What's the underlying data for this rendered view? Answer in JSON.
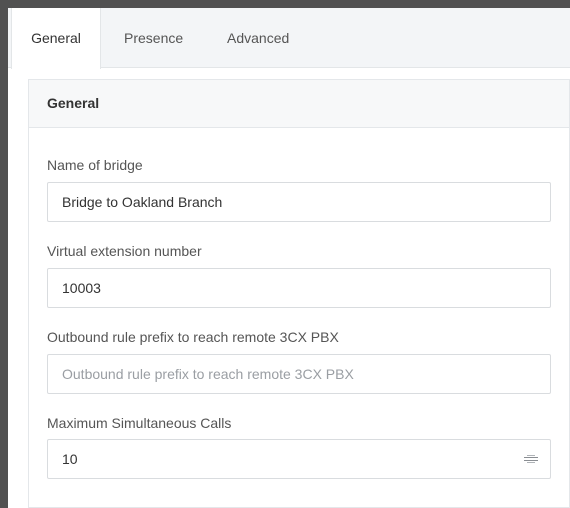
{
  "tabs": [
    {
      "label": "General",
      "active": true
    },
    {
      "label": "Presence",
      "active": false
    },
    {
      "label": "Advanced",
      "active": false
    }
  ],
  "panel": {
    "title": "General",
    "fields": {
      "name": {
        "label": "Name of bridge",
        "value": "Bridge to Oakland Branch"
      },
      "extension": {
        "label": "Virtual extension number",
        "value": "10003"
      },
      "prefix": {
        "label": "Outbound rule prefix to reach remote 3CX PBX",
        "value": "",
        "placeholder": "Outbound rule prefix to reach remote 3CX PBX"
      },
      "max_calls": {
        "label": "Maximum Simultaneous Calls",
        "value": "10"
      }
    }
  },
  "colors": {
    "background": "#515151",
    "tabbar": "#f3f5f7",
    "panel_header": "#f7f8f9",
    "border": "#e4e7ea"
  },
  "icons": {
    "stepper": "spin-arrows-icon"
  }
}
